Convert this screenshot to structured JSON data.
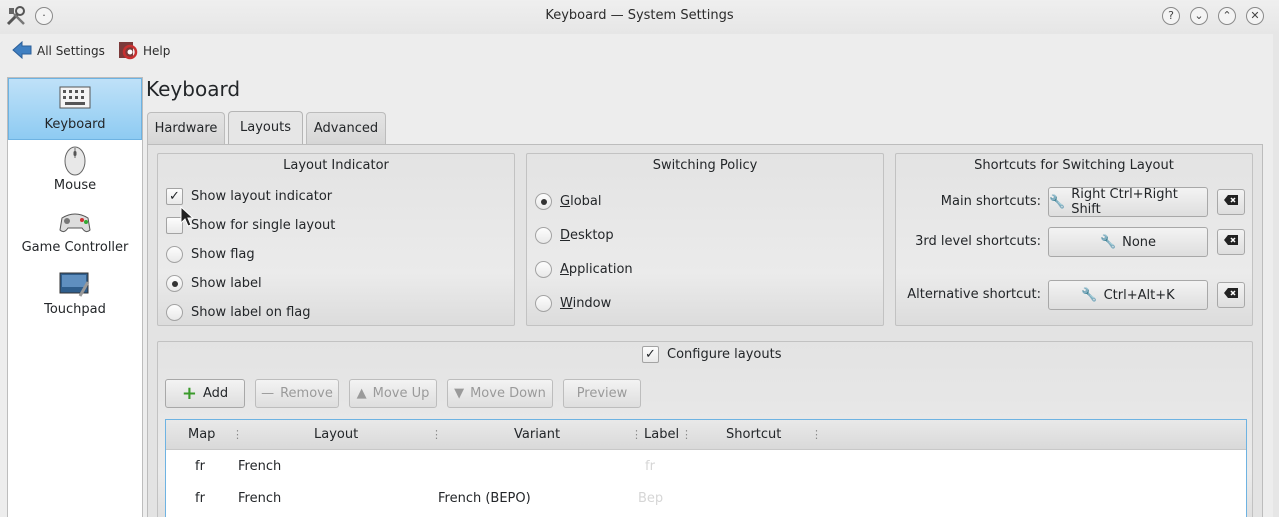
{
  "window": {
    "title": "Keyboard — System Settings"
  },
  "toolbar": {
    "all_settings": "All Settings",
    "help": "Help"
  },
  "sidebar": {
    "items": [
      {
        "label": "Keyboard"
      },
      {
        "label": "Mouse"
      },
      {
        "label": "Game Controller"
      },
      {
        "label": "Touchpad"
      }
    ]
  },
  "page": {
    "title": "Keyboard"
  },
  "tabs": [
    {
      "label": "Hardware"
    },
    {
      "label": "Layouts"
    },
    {
      "label": "Advanced"
    }
  ],
  "layout_indicator": {
    "title": "Layout Indicator",
    "show_indicator": "Show layout indicator",
    "show_single": "Show for single layout",
    "show_flag": "Show flag",
    "show_label": "Show label",
    "show_label_on_flag": "Show label on flag"
  },
  "switching_policy": {
    "title": "Switching Policy",
    "options": [
      {
        "key": "G",
        "rest": "lobal"
      },
      {
        "key": "D",
        "rest": "esktop"
      },
      {
        "key": "A",
        "rest": "pplication"
      },
      {
        "key": "W",
        "rest": "indow"
      }
    ]
  },
  "shortcuts": {
    "title": "Shortcuts for Switching Layout",
    "main_label": "Main shortcuts:",
    "main_value": "Right Ctrl+Right Shift",
    "third_label": "3rd level shortcuts:",
    "third_value": "None",
    "alt_label": "Alternative shortcut:",
    "alt_value": "Ctrl+Alt+K"
  },
  "configure": {
    "label": "Configure layouts",
    "add": "Add",
    "remove": "Remove",
    "move_up": "Move Up",
    "move_down": "Move Down",
    "preview": "Preview"
  },
  "table": {
    "columns": [
      "Map",
      "Layout",
      "Variant",
      "Label",
      "Shortcut"
    ],
    "rows": [
      {
        "map": "fr",
        "layout": "French",
        "variant": "",
        "label": "fr",
        "shortcut": ""
      },
      {
        "map": "fr",
        "layout": "French",
        "variant": "French (BEPO)",
        "label": "Bep",
        "shortcut": ""
      }
    ]
  },
  "colors": {
    "selection": "#8ecbf2",
    "accent_border": "#6eb3e2",
    "add_green": "#3a9a2b"
  }
}
